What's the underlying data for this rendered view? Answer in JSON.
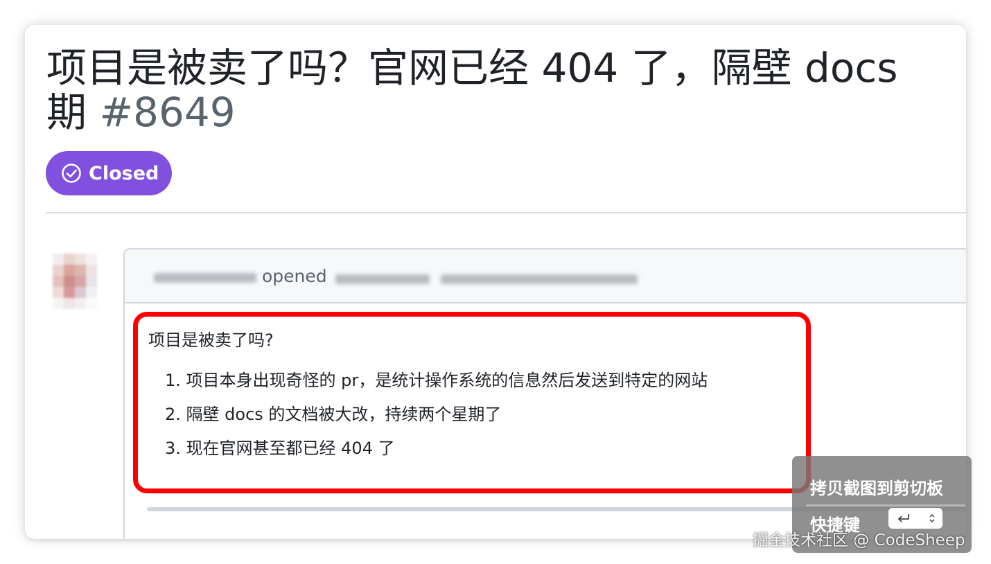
{
  "issue": {
    "title_line1": "项目是被卖了吗？官网已经 404 了，隔壁 docs",
    "title_line2": "期",
    "number": "#8649",
    "status": "Closed",
    "status_color": "#8250df"
  },
  "comment": {
    "opened_text": "opened",
    "question": "项目是被卖了吗?",
    "points": [
      "1. 项目本身出现奇怪的 pr，是统计操作系统的信息然后发送到特定的网站",
      "2. 隔壁 docs 的文档被大改，持续两个星期了",
      "3. 现在官网甚至都已经 404 了"
    ],
    "highlight_color": "#ff0000"
  },
  "screenshot_tool": {
    "copy_label": "拷贝截图到剪切板",
    "shortcut_label": "快捷键",
    "shortcut_icon": "return-icon",
    "selector_icon": "updown-chevron-icon"
  },
  "watermark": "掘金技术社区 @ CodeSheep"
}
